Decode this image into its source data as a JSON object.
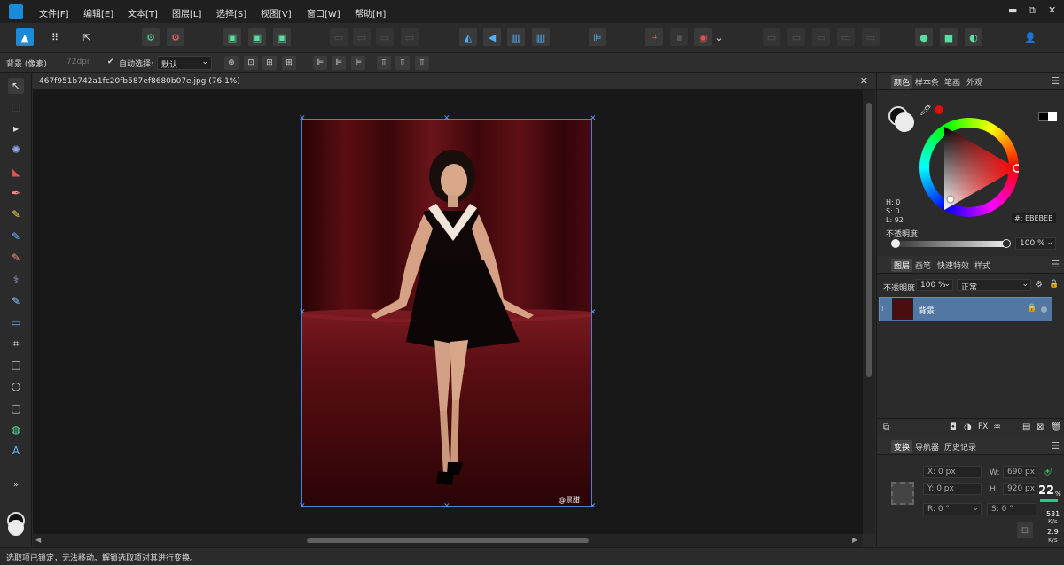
{
  "menubar": {
    "items": [
      "文件[F]",
      "编辑[E]",
      "文本[T]",
      "图层[L]",
      "选择[S]",
      "视图[V]",
      "窗口[W]",
      "帮助[H]"
    ],
    "window_controls": [
      "▬",
      "⧉",
      "✕"
    ]
  },
  "context": {
    "layer_name": "背景 (像素)",
    "dpi": "72dpi",
    "auto_select_label": "自动选择:",
    "auto_select_value": "默认"
  },
  "document": {
    "tab_title": "467f951b742a1fc20fb587ef8680b07e.jpg (76.1%)",
    "watermark": "@景甜"
  },
  "color_panel": {
    "tabs": [
      "颜色",
      "样本条",
      "笔画",
      "外观"
    ],
    "hsl": [
      "H: 0",
      "S: 0",
      "L: 92"
    ],
    "hex": "#: EBEBEB",
    "opacity_label": "不透明度",
    "opacity_value": "100 %",
    "accent_red": "#e01010"
  },
  "layers_panel": {
    "tabs": [
      "图层",
      "画笔",
      "快速特效",
      "样式"
    ],
    "opacity_label": "不透明度:",
    "opacity_value": "100 %",
    "blend_mode": "正常",
    "layer_name": "背景"
  },
  "transform_panel": {
    "tabs": [
      "变换",
      "导航器",
      "历史记录"
    ],
    "x": "X: 0 px",
    "y": "Y: 0 px",
    "w_label": "W:",
    "w_value": "690 px",
    "h_label": "H:",
    "h_value": "920 px",
    "r": "R: 0 °",
    "s": "S: 0 °"
  },
  "net_widget": {
    "percent": "22",
    "percent_unit": "%",
    "up": "531",
    "up_unit": "K/s",
    "down": "2.9",
    "down_unit": "K/s"
  },
  "status": {
    "text": "选取项已锁定，无法移动。解锁选取项对其进行变换。"
  }
}
